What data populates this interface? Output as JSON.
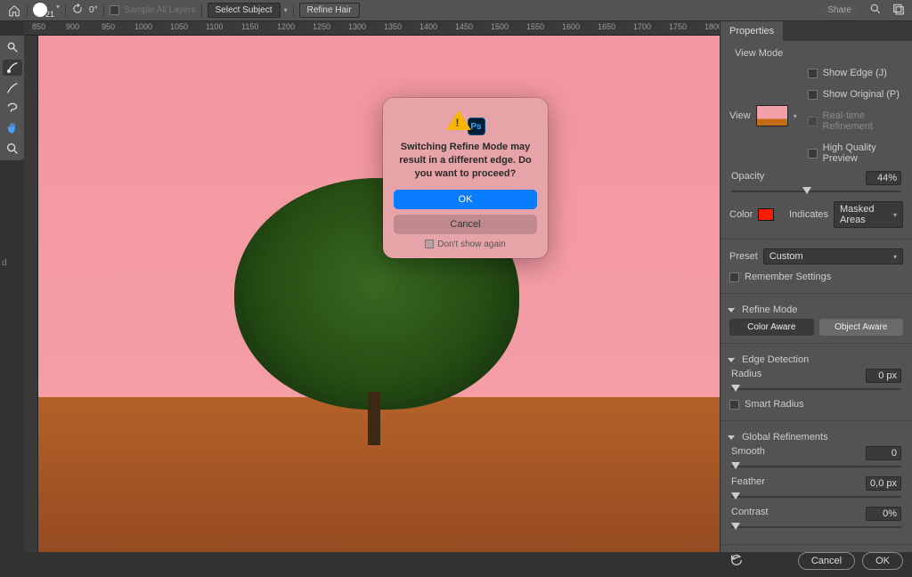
{
  "topbar": {
    "brush_size": "21",
    "angle": "0°",
    "sample_all_layers": "Sample All Layers",
    "select_subject": "Select Subject",
    "refine_hair": "Refine Hair",
    "share": "Share"
  },
  "ruler_h": [
    "850",
    "900",
    "950",
    "1000",
    "1050",
    "1100",
    "1150",
    "1200",
    "1250",
    "1300",
    "1350",
    "1400",
    "1450",
    "1500",
    "1550",
    "1600",
    "1650",
    "1700",
    "1750",
    "1800"
  ],
  "modal": {
    "message": "Switching Refine Mode may result in a different edge. Do you want to proceed?",
    "ok": "OK",
    "cancel": "Cancel",
    "dont_show": "Don't show again",
    "ps": "Ps"
  },
  "props": {
    "tab": "Properties",
    "view_mode": "View Mode",
    "view": "View",
    "show_edge": "Show Edge (J)",
    "show_original": "Show Original (P)",
    "realtime": "Real-time Refinement",
    "hq_preview": "High Quality Preview",
    "opacity": "Opacity",
    "opacity_val": "44%",
    "color": "Color",
    "indicates": "Indicates",
    "indicates_val": "Masked Areas",
    "preset": "Preset",
    "preset_val": "Custom",
    "remember": "Remember Settings",
    "refine_mode": "Refine Mode",
    "color_aware": "Color Aware",
    "object_aware": "Object Aware",
    "edge_detection": "Edge Detection",
    "radius": "Radius",
    "radius_val": "0 px",
    "smart_radius": "Smart Radius",
    "global_refinements": "Global Refinements",
    "smooth": "Smooth",
    "smooth_val": "0",
    "feather": "Feather",
    "feather_val": "0,0 px",
    "contrast": "Contrast",
    "contrast_val": "0%",
    "cancel": "Cancel",
    "ok": "OK"
  }
}
